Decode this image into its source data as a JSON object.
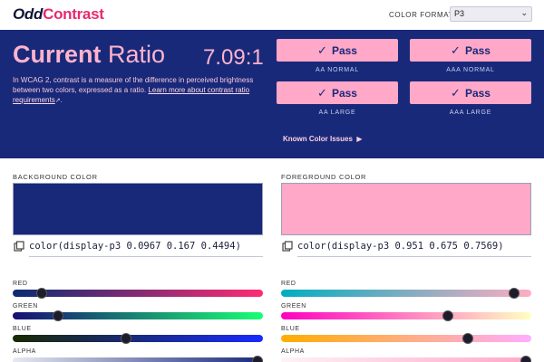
{
  "header": {
    "logo_odd": "Odd",
    "logo_contrast": "Contrast",
    "color_format_label": "COLOR FORMAT",
    "color_format_value": "P3"
  },
  "ratio": {
    "title_bold": "Current",
    "title_rest": " Ratio",
    "value": "7.09:1",
    "desc_text": "In WCAG 2, contrast is a measure of the difference in perceived brightness between two colors, expressed as a ratio. ",
    "desc_link": "Learn more about contrast ratio requirements",
    "known_issues": "Known Color Issues"
  },
  "results": [
    {
      "label": "Pass",
      "caption": "AA NORMAL"
    },
    {
      "label": "Pass",
      "caption": "AAA NORMAL"
    },
    {
      "label": "Pass",
      "caption": "AA LARGE"
    },
    {
      "label": "Pass",
      "caption": "AAA LARGE"
    }
  ],
  "background": {
    "title": "BACKGROUND COLOR",
    "swatch_color": "#18297a",
    "value": "color(display-p3 0.0967 0.167 0.4494)",
    "sliders": [
      {
        "label": "RED",
        "level": 0.0967
      },
      {
        "label": "GREEN",
        "level": 0.167
      },
      {
        "label": "BLUE",
        "level": 0.4494
      },
      {
        "label": "ALPHA",
        "level": 1.0
      }
    ]
  },
  "foreground": {
    "title": "FOREGROUND COLOR",
    "swatch_color": "#ffa8c8",
    "value": "color(display-p3 0.951 0.675 0.7569)",
    "sliders": [
      {
        "label": "RED",
        "level": 0.951
      },
      {
        "label": "GREEN",
        "level": 0.675
      },
      {
        "label": "BLUE",
        "level": 0.7569
      },
      {
        "label": "ALPHA",
        "level": 1.0
      }
    ]
  },
  "icons": {
    "copy": "copy-icon",
    "check": "check-icon",
    "external": "external-link-icon",
    "chevron": "chevron-down-icon",
    "arrow": "triangle-right-icon"
  }
}
